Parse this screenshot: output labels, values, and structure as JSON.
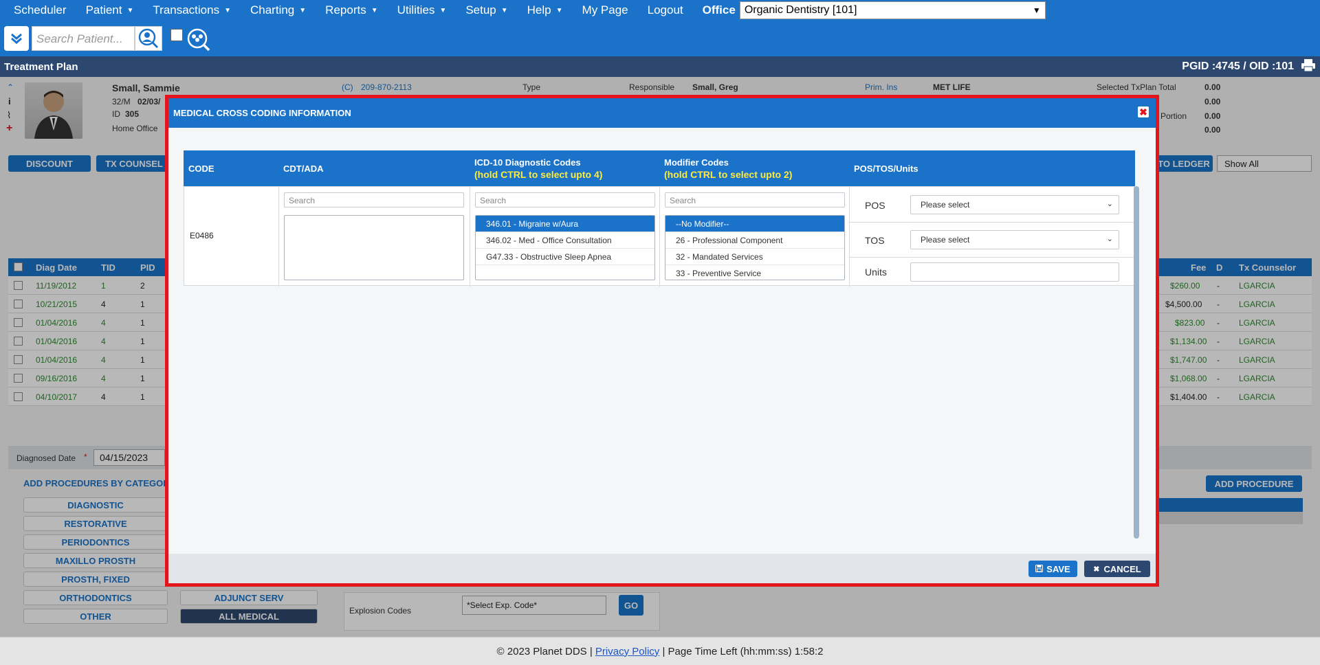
{
  "nav": {
    "items": [
      {
        "label": "Scheduler",
        "caret": false
      },
      {
        "label": "Patient",
        "caret": true
      },
      {
        "label": "Transactions",
        "caret": true
      },
      {
        "label": "Charting",
        "caret": true
      },
      {
        "label": "Reports",
        "caret": true
      },
      {
        "label": "Utilities",
        "caret": true
      },
      {
        "label": "Setup",
        "caret": true
      },
      {
        "label": "Help",
        "caret": true
      },
      {
        "label": "My Page",
        "caret": false
      },
      {
        "label": "Logout",
        "caret": false
      }
    ],
    "office_label": "Office",
    "office_value": "Organic Dentistry [101]"
  },
  "search": {
    "placeholder": "Search Patient..."
  },
  "title": {
    "text": "Treatment Plan",
    "ids": "PGID :4745  /  OID :101"
  },
  "patient": {
    "name": "Small, Sammie",
    "age_sex": "32/M",
    "dob": "02/03/",
    "id_label": "ID",
    "id_value": "305",
    "office": "Home Office",
    "phone_label": "(C)",
    "phone": "209-870-2113",
    "type_label": "Type",
    "responsible_label": "Responsible",
    "responsible": "Small, Greg",
    "prim_ins_label": "Prim. Ins",
    "prim_ins": "MET LIFE",
    "txplan_total_label": "Selected TxPlan Total",
    "txplan_total": "0.00",
    "portion_label": "Portion",
    "amounts": [
      "0.00",
      "0.00",
      "0.00"
    ]
  },
  "bg_buttons": {
    "discount": "DISCOUNT",
    "tx_counsel": "TX COUNSEL",
    "to_ledger": "TO LEDGER",
    "show_all": "Show All"
  },
  "bg_table": {
    "headers": {
      "diag_date": "Diag Date",
      "tid": "TID",
      "pid": "PID",
      "fee": "Fee",
      "d": "D",
      "counselor": "Tx Counselor"
    },
    "rows": [
      {
        "date": "11/19/2012",
        "tid": "1",
        "pid": "2",
        "fee": "$260.00",
        "d": "-",
        "counselor": "LGARCIA"
      },
      {
        "date": "10/21/2015",
        "tid": "4",
        "pid": "1",
        "fee": "$4,500.00",
        "d": "-",
        "counselor": "LGARCIA"
      },
      {
        "date": "01/04/2016",
        "tid": "4",
        "pid": "1",
        "fee": "$823.00",
        "d": "-",
        "counselor": "LGARCIA"
      },
      {
        "date": "01/04/2016",
        "tid": "4",
        "pid": "1",
        "fee": "$1,134.00",
        "d": "-",
        "counselor": "LGARCIA"
      },
      {
        "date": "01/04/2016",
        "tid": "4",
        "pid": "1",
        "fee": "$1,747.00",
        "d": "-",
        "counselor": "LGARCIA"
      },
      {
        "date": "09/16/2016",
        "tid": "4",
        "pid": "1",
        "fee": "$1,068.00",
        "d": "-",
        "counselor": "LGARCIA"
      },
      {
        "date": "04/10/2017",
        "tid": "4",
        "pid": "1",
        "fee": "$1,404.00",
        "d": "-",
        "counselor": "LGARCIA"
      }
    ]
  },
  "bg_lower": {
    "diag_date_label": "Diagnosed Date",
    "diag_date_value": "04/15/2023",
    "add_by_cat": "ADD PROCEDURES BY CATEGORIE",
    "categories": [
      "DIAGNOSTIC",
      "RESTORATIVE",
      "PERIODONTICS",
      "MAXILLO PROSTH",
      "PROSTH, FIXED",
      "ORTHODONTICS",
      "OTHER"
    ],
    "adjunct": "ADJUNCT SERV",
    "all_medical": "ALL MEDICAL",
    "explosion_label": "Explosion Codes",
    "explosion_value": "*Select Exp. Code*",
    "go": "GO",
    "add_procedure": "ADD PROCEDURE"
  },
  "modal": {
    "title": "MEDICAL CROSS CODING INFORMATION",
    "headers": {
      "code": "CODE",
      "cdt": "CDT/ADA",
      "icd": "ICD-10 Diagnostic Codes",
      "icd_hint": "(hold CTRL to select upto 4)",
      "modifier": "Modifier Codes",
      "modifier_hint": "(hold CTRL to select upto 2)",
      "pos": "POS/TOS/Units"
    },
    "row": {
      "code": "E0486",
      "cdt_search_placeholder": "Search",
      "icd_search_placeholder": "Search",
      "modifier_search_placeholder": "Search",
      "icd_options": [
        "346.01 - Migraine w/Aura",
        "346.02 - Med - Office Consultation",
        "G47.33 - Obstructive Sleep Apnea"
      ],
      "modifier_options": [
        "--No Modifier--",
        "26 - Professional Component",
        "32 - Mandated Services",
        "33 - Preventive Service"
      ],
      "pos_label": "POS",
      "pos_value": "Please select",
      "tos_label": "TOS",
      "tos_value": "Please select",
      "units_label": "Units",
      "units_value": ""
    },
    "save": "SAVE",
    "cancel": "CANCEL"
  },
  "footer": {
    "copyright": "© 2023 Planet DDS |",
    "privacy": "Privacy Policy",
    "time": "|  Page Time Left (hh:mm:ss) 1:58:2"
  }
}
